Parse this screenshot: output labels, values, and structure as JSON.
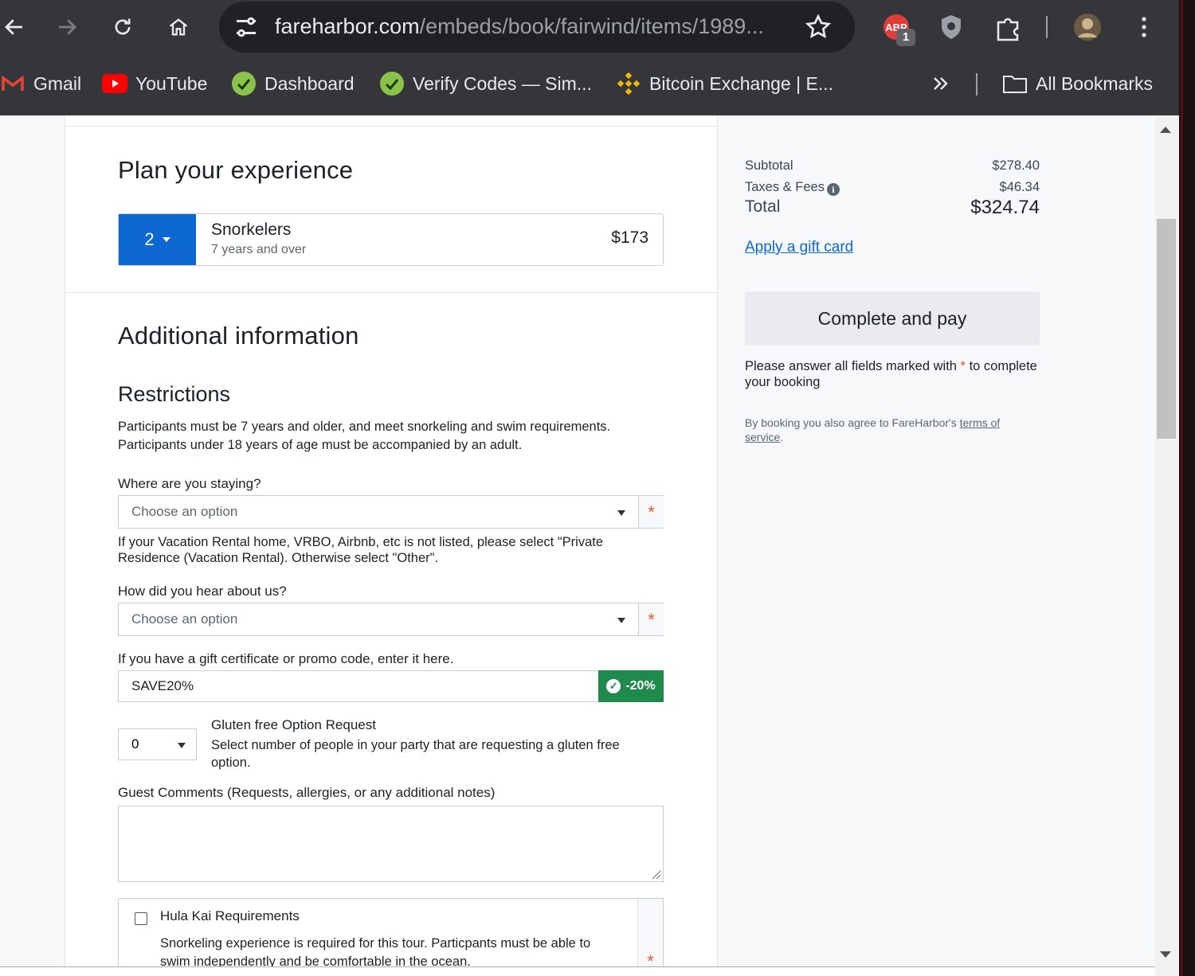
{
  "browser": {
    "url_host": "fareharbor.com",
    "url_path": "/embeds/book/fairwind/items/1989...",
    "extension_badge": "1",
    "bookmarks": [
      {
        "label": "Gmail"
      },
      {
        "label": "YouTube"
      },
      {
        "label": "Dashboard"
      },
      {
        "label": "Verify Codes — Sim..."
      },
      {
        "label": "Bitcoin Exchange | E..."
      }
    ],
    "all_bookmarks": "All Bookmarks"
  },
  "plan": {
    "title": "Plan your experience",
    "quantity": "2",
    "customer_type": "Snorkelers",
    "customer_sub": "7 years and over",
    "price": "$173"
  },
  "additional": {
    "title": "Additional information",
    "restrictions_title": "Restrictions",
    "restrictions_line1": "Participants must be 7 years and older, and meet snorkeling and swim requirements.",
    "restrictions_line2": "Participants under 18 years of age must be accompanied by an adult.",
    "staying_label": "Where are you staying?",
    "staying_placeholder": "Choose an option",
    "staying_help1": "If your Vacation Rental home, VRBO, Airbnb, etc is not listed, please select \"Private",
    "staying_help2": "Residence (Vacation Rental). Otherwise select \"Other\".",
    "hear_label": "How did you hear about us?",
    "hear_placeholder": "Choose an option",
    "promo_label": "If you have a gift certificate or promo code, enter it here.",
    "promo_value": "SAVE20%",
    "promo_badge": "-20%",
    "gf_value": "0",
    "gf_title": "Gluten free Option Request",
    "gf_desc1": "Select number of people in your party that are requesting a gluten free",
    "gf_desc2": "option.",
    "comments_label": "Guest Comments (Requests, allergies, or any additional notes)",
    "hula_title": "Hula Kai Requirements",
    "hula_desc1": "Snorkeling experience is required for this tour. Particpants must be able to",
    "hula_desc2": "swim independently and be comfortable in the ocean.",
    "required_mark": "*"
  },
  "summary": {
    "subtotal_label": "Subtotal",
    "subtotal": "$278.40",
    "taxes_label": "Taxes & Fees",
    "taxes": "$46.34",
    "total_label": "Total",
    "total": "$324.74",
    "gift_link": "Apply a gift card",
    "pay_button": "Complete and pay",
    "note_pre": "Please answer all fields marked with",
    "note_star": "*",
    "note_post": "to complete your booking",
    "terms_pre": "By booking you also agree to FareHarbor's",
    "terms_link": "terms of service",
    "terms_post": "."
  },
  "colors": {
    "accent": "#0c67d1",
    "success": "#1e8a4c",
    "required": "#e4572e"
  }
}
